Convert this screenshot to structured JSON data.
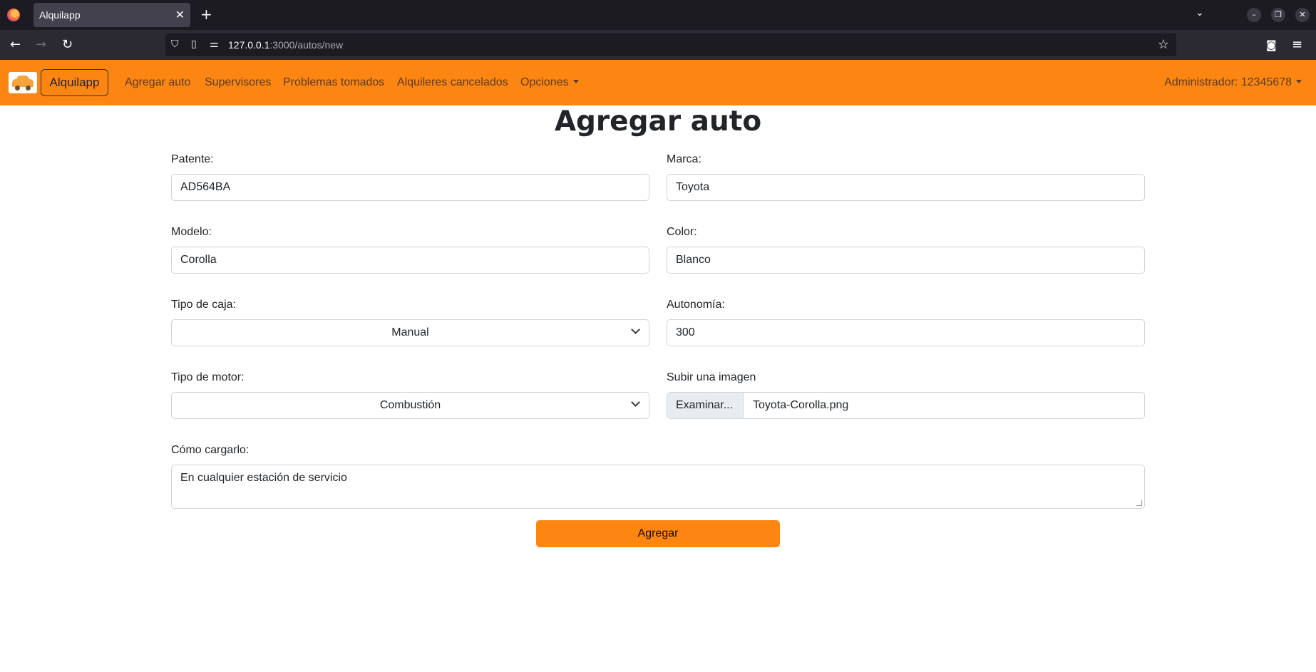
{
  "browser": {
    "tab_title": "Alquilapp",
    "tab_close": "✕",
    "new_tab": "+",
    "url_host": "127.0.0.1",
    "url_path": ":3000/autos/new"
  },
  "navbar": {
    "brand": "Alquilapp",
    "links": [
      "Agregar auto",
      "Supervisores",
      "Problemas tomados",
      "Alquileres cancelados",
      "Opciones"
    ],
    "user": "Administrador: 12345678"
  },
  "form": {
    "title": "Agregar auto",
    "patente": {
      "label": "Patente:",
      "value": "AD564BA"
    },
    "marca": {
      "label": "Marca:",
      "value": "Toyota"
    },
    "modelo": {
      "label": "Modelo:",
      "value": "Corolla"
    },
    "color": {
      "label": "Color:",
      "value": "Blanco"
    },
    "tipo_caja": {
      "label": "Tipo de caja:",
      "value": "Manual"
    },
    "autonomia": {
      "label": "Autonomía:",
      "value": "300"
    },
    "tipo_motor": {
      "label": "Tipo de motor:",
      "value": "Combustión"
    },
    "imagen": {
      "label": "Subir una imagen",
      "button": "Examinar...",
      "filename": "Toyota-Corolla.png"
    },
    "como_cargarlo": {
      "label": "Cómo cargarlo:",
      "value": "En cualquier estación de servicio"
    },
    "submit": "Agregar"
  },
  "colors": {
    "navbar": "#fd8512",
    "button": "#fd8512"
  }
}
